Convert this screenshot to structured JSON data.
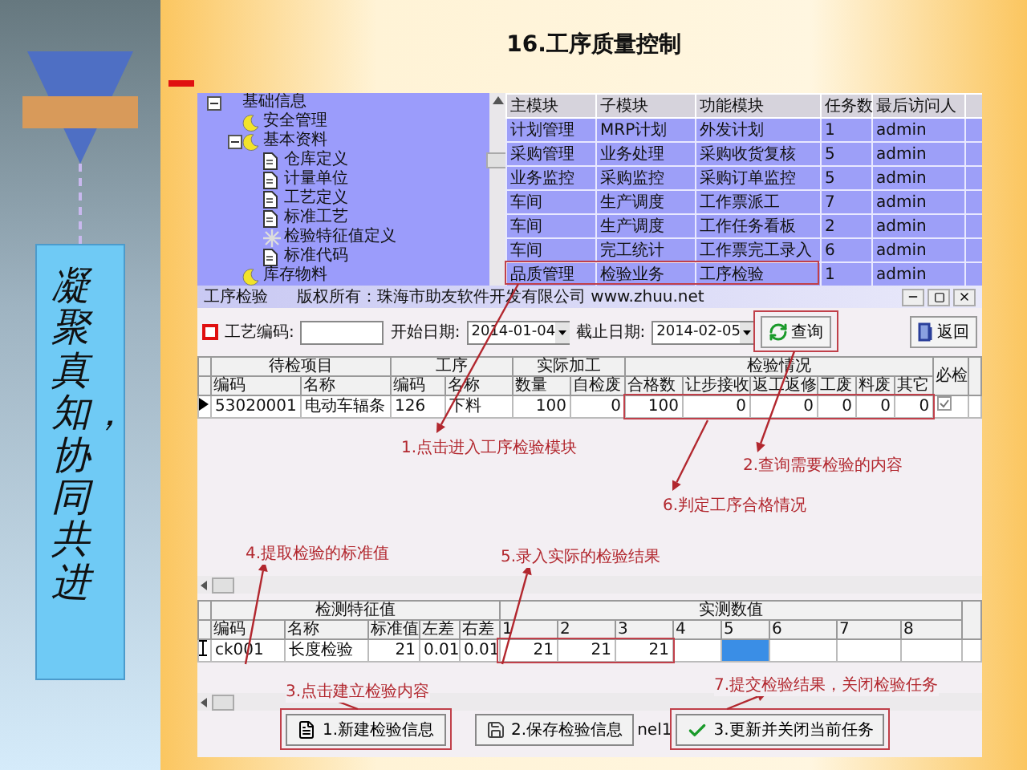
{
  "sidebar": {
    "motto": "凝聚真知，协同共进"
  },
  "title": "16.工序质量控制",
  "tree": {
    "items": [
      {
        "label": "基础信息",
        "expanded": true,
        "children": [
          {
            "label": "安全管理",
            "kind": "group"
          },
          {
            "label": "基本资料",
            "kind": "group",
            "expanded": true,
            "children": [
              {
                "label": "仓库定义",
                "kind": "form"
              },
              {
                "label": "计量单位",
                "kind": "form"
              },
              {
                "label": "工艺定义",
                "kind": "form"
              },
              {
                "label": "标准工艺",
                "kind": "form"
              },
              {
                "label": "检验特征值定义",
                "kind": "setting"
              },
              {
                "label": "标准代码",
                "kind": "form"
              }
            ]
          },
          {
            "label": "库存物料",
            "kind": "group"
          }
        ]
      }
    ]
  },
  "module_grid": {
    "columns": [
      "主模块",
      "子模块",
      "功能模块",
      "任务数",
      "最后访问人"
    ],
    "rows": [
      [
        "计划管理",
        "MRP计划",
        "外发计划",
        "1",
        "admin"
      ],
      [
        "采购管理",
        "业务处理",
        "采购收货复核",
        "5",
        "admin"
      ],
      [
        "业务监控",
        "采购监控",
        "采购订单监控",
        "5",
        "admin"
      ],
      [
        "车间",
        "生产调度",
        "工作票派工",
        "7",
        "admin"
      ],
      [
        "车间",
        "生产调度",
        "工作任务看板",
        "2",
        "admin"
      ],
      [
        "车间",
        "完工统计",
        "工作票完工录入",
        "6",
        "admin"
      ],
      [
        "品质管理",
        "检验业务",
        "工序检验",
        "1",
        "admin"
      ]
    ]
  },
  "window": {
    "title": "工序检验",
    "copyright": "版权所有：珠海市助友软件开发有限公司 www.zhuu.net"
  },
  "toolbar": {
    "process_code_label": "工艺编码:",
    "start_label": "开始日期:",
    "start_date": "2014-01-04",
    "end_label": "截止日期:",
    "end_date": "2014-02-05",
    "query_button": "查询",
    "back_button": "返回"
  },
  "inspection_table": {
    "groups": [
      {
        "label": "待检项目",
        "columns": [
          "编码",
          "名称"
        ]
      },
      {
        "label": "工序",
        "columns": [
          "编码",
          "名称"
        ]
      },
      {
        "label": "实际加工",
        "columns": [
          "数量",
          "自检废"
        ]
      },
      {
        "label": "检验情况",
        "columns": [
          "合格数",
          "让步接收",
          "返工返修",
          "工废",
          "料废",
          "其它"
        ]
      }
    ],
    "required_column": "必检",
    "rows": [
      {
        "current": true,
        "required": true,
        "cells": [
          "53020001",
          "电动车辐条",
          "126",
          "下料",
          "100",
          "0",
          "100",
          "0",
          "0",
          "0",
          "0",
          "0"
        ]
      }
    ]
  },
  "annotations": [
    "1.点击进入工序检验模块",
    "2.查询需要检验的内容",
    "6.判定工序合格情况",
    "4.提取检验的标准值",
    "5.录入实际的检验结果",
    "3.点击建立检验内容",
    "7.提交检验结果，关闭检验任务"
  ],
  "feature_table": {
    "groups": [
      {
        "label": "检测特征值",
        "columns": [
          "编码",
          "名称",
          "标准值",
          "左差",
          "右差"
        ]
      },
      {
        "label": "实测数值",
        "columns": [
          "1",
          "2",
          "3",
          "4",
          "5",
          "6",
          "7",
          "8"
        ]
      }
    ],
    "rows": [
      {
        "editing": true,
        "cells": [
          "ck001",
          "长度检验",
          "21",
          "0.01",
          "0.01"
        ],
        "measurements": [
          {
            "value": "21",
            "selected": false
          },
          {
            "value": "21",
            "selected": false
          },
          {
            "value": "21",
            "selected": false
          },
          {
            "selected": false
          },
          {
            "selected": true
          },
          {
            "selected": false
          },
          {
            "selected": false
          },
          {
            "selected": false
          }
        ]
      }
    ]
  },
  "buttons": [
    {
      "label": "1.新建检验信息",
      "kind": "new"
    },
    {
      "label": "2.保存检验信息",
      "kind": "save"
    },
    {
      "label": "3.更新并关闭当前任务",
      "kind": "confirm"
    }
  ],
  "panel_label": "nel1"
}
